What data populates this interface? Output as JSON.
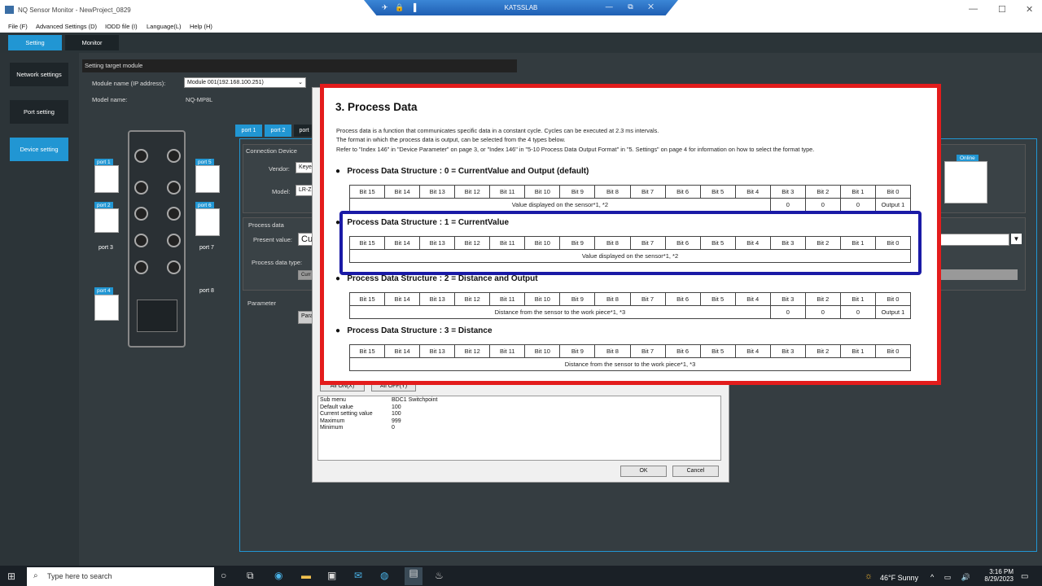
{
  "window": {
    "title": "NQ Sensor Monitor - NewProject_0829",
    "remote_title": "KATSSLAB"
  },
  "menu": [
    "File (F)",
    "Advanced Settings (D)",
    "IODD file (I)",
    "Language(L)",
    "Help (H)"
  ],
  "tabs": [
    "Setting",
    "Monitor"
  ],
  "nav": [
    "Network settings",
    "Port setting",
    "Device setting"
  ],
  "target": {
    "header": "Setting target module",
    "module_label": "Module name (IP address):",
    "module_value": "Module 001(192.168.100.251)",
    "model_label": "Model name:",
    "model_value": "NQ-MP8L"
  },
  "ports": [
    "port 1",
    "port 2",
    "port 3",
    "port 4",
    "port 5",
    "port 6",
    "port 7",
    "port 8"
  ],
  "port_tabs": [
    "port 1",
    "port 2",
    "port"
  ],
  "conn_device": {
    "header": "Connection Device",
    "vendor_label": "Vendor:",
    "vendor_value": "Keye",
    "model_label": "Model:",
    "model_value": "LR-Z"
  },
  "process_data": {
    "header": "Process data",
    "present_label": "Present value:",
    "present_value": "Cu",
    "type_label": "Process data type:",
    "type_value": "Curr"
  },
  "parameter": {
    "header": "Parameter",
    "button": "Para"
  },
  "online": "Online",
  "dialog": {
    "all_on": "All ON(X)",
    "all_off": "All OFF(Y)",
    "info_labels": [
      "Sub menu",
      "Default value",
      "Current setting value",
      "Maximum",
      "Minimum"
    ],
    "info_values": [
      "BDC1 Switchpoint",
      "100",
      "100",
      "999",
      "0"
    ],
    "ok": "OK",
    "cancel": "Cancel"
  },
  "doc": {
    "heading": "3.  Process Data",
    "para1": "Process data is a function that communicates specific data in a constant cycle. Cycles can be executed at 2.3 ms intervals.",
    "para2": "The format in which the process data is output, can be selected from the 4 types below.",
    "para3": "Refer to \"Index 146\" in \"Device Parameter\" on page 3, or \"Index 146\" in \"5-10 Process Data Output Format\" in \"5. Settings\" on page 4 for information on how to select the format type.",
    "s0": "Process Data Structure : 0 = CurrentValue and Output (default)",
    "s1": "Process Data Structure : 1 = CurrentValue",
    "s2": "Process Data Structure : 2 = Distance and Output",
    "s3": "Process Data Structure : 3 = Distance",
    "bits": [
      "Bit 15",
      "Bit 14",
      "Bit 13",
      "Bit 12",
      "Bit 11",
      "Bit 10",
      "Bit 9",
      "Bit 8",
      "Bit 7",
      "Bit 6",
      "Bit 5",
      "Bit 4",
      "Bit 3",
      "Bit 2",
      "Bit 1",
      "Bit 0"
    ],
    "row0": "Value displayed on the sensor*1, *2",
    "row1": "Value displayed on the sensor*1, *2",
    "row2": "Distance from the sensor to the work piece*1, *3",
    "row3": "Distance from the sensor to the work piece*1, *3",
    "zero": "0",
    "output1": "Output 1"
  },
  "taskbar": {
    "search": "Type here to search",
    "weather": "46°F  Sunny",
    "time": "3:16 PM",
    "date": "8/29/2023"
  }
}
